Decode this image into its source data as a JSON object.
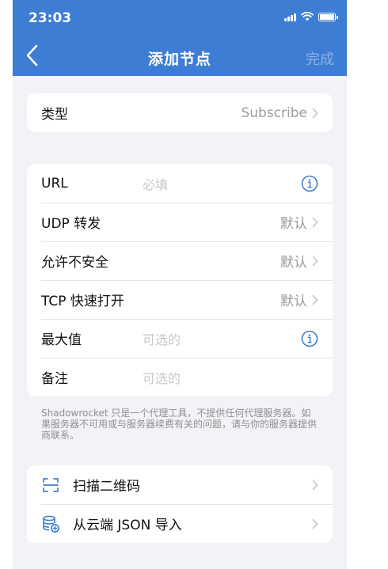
{
  "status": {
    "time": "23:03"
  },
  "nav": {
    "title": "添加节点",
    "done": "完成"
  },
  "type_row": {
    "label": "类型",
    "value": "Subscribe"
  },
  "fields": [
    {
      "label": "URL",
      "placeholder": "必填",
      "trailing": "info-icon"
    },
    {
      "label": "UDP 转发",
      "value": "默认",
      "trailing": "chevron-right-icon"
    },
    {
      "label": "允许不安全",
      "value": "默认",
      "trailing": "chevron-right-icon"
    },
    {
      "label": "TCP 快速打开",
      "value": "默认",
      "trailing": "chevron-right-icon"
    },
    {
      "label": "最大值",
      "placeholder": "可选的",
      "trailing": "info-icon"
    },
    {
      "label": "备注",
      "placeholder": "可选的"
    }
  ],
  "footnote": "Shadowrocket 只是一个代理工具，不提供任何代理服务器。如果服务器不可用或与服务器续费有关的问题，请与你的服务器提供商联系。",
  "actions": [
    {
      "label": "扫描二维码",
      "icon": "qr-scan-icon"
    },
    {
      "label": "从云端 JSON 导入",
      "icon": "cloud-database-icon"
    }
  ],
  "colors": {
    "accent": "#3d7dd3",
    "background": "#f2f2f7",
    "secondary_text": "#9b9ba0"
  }
}
